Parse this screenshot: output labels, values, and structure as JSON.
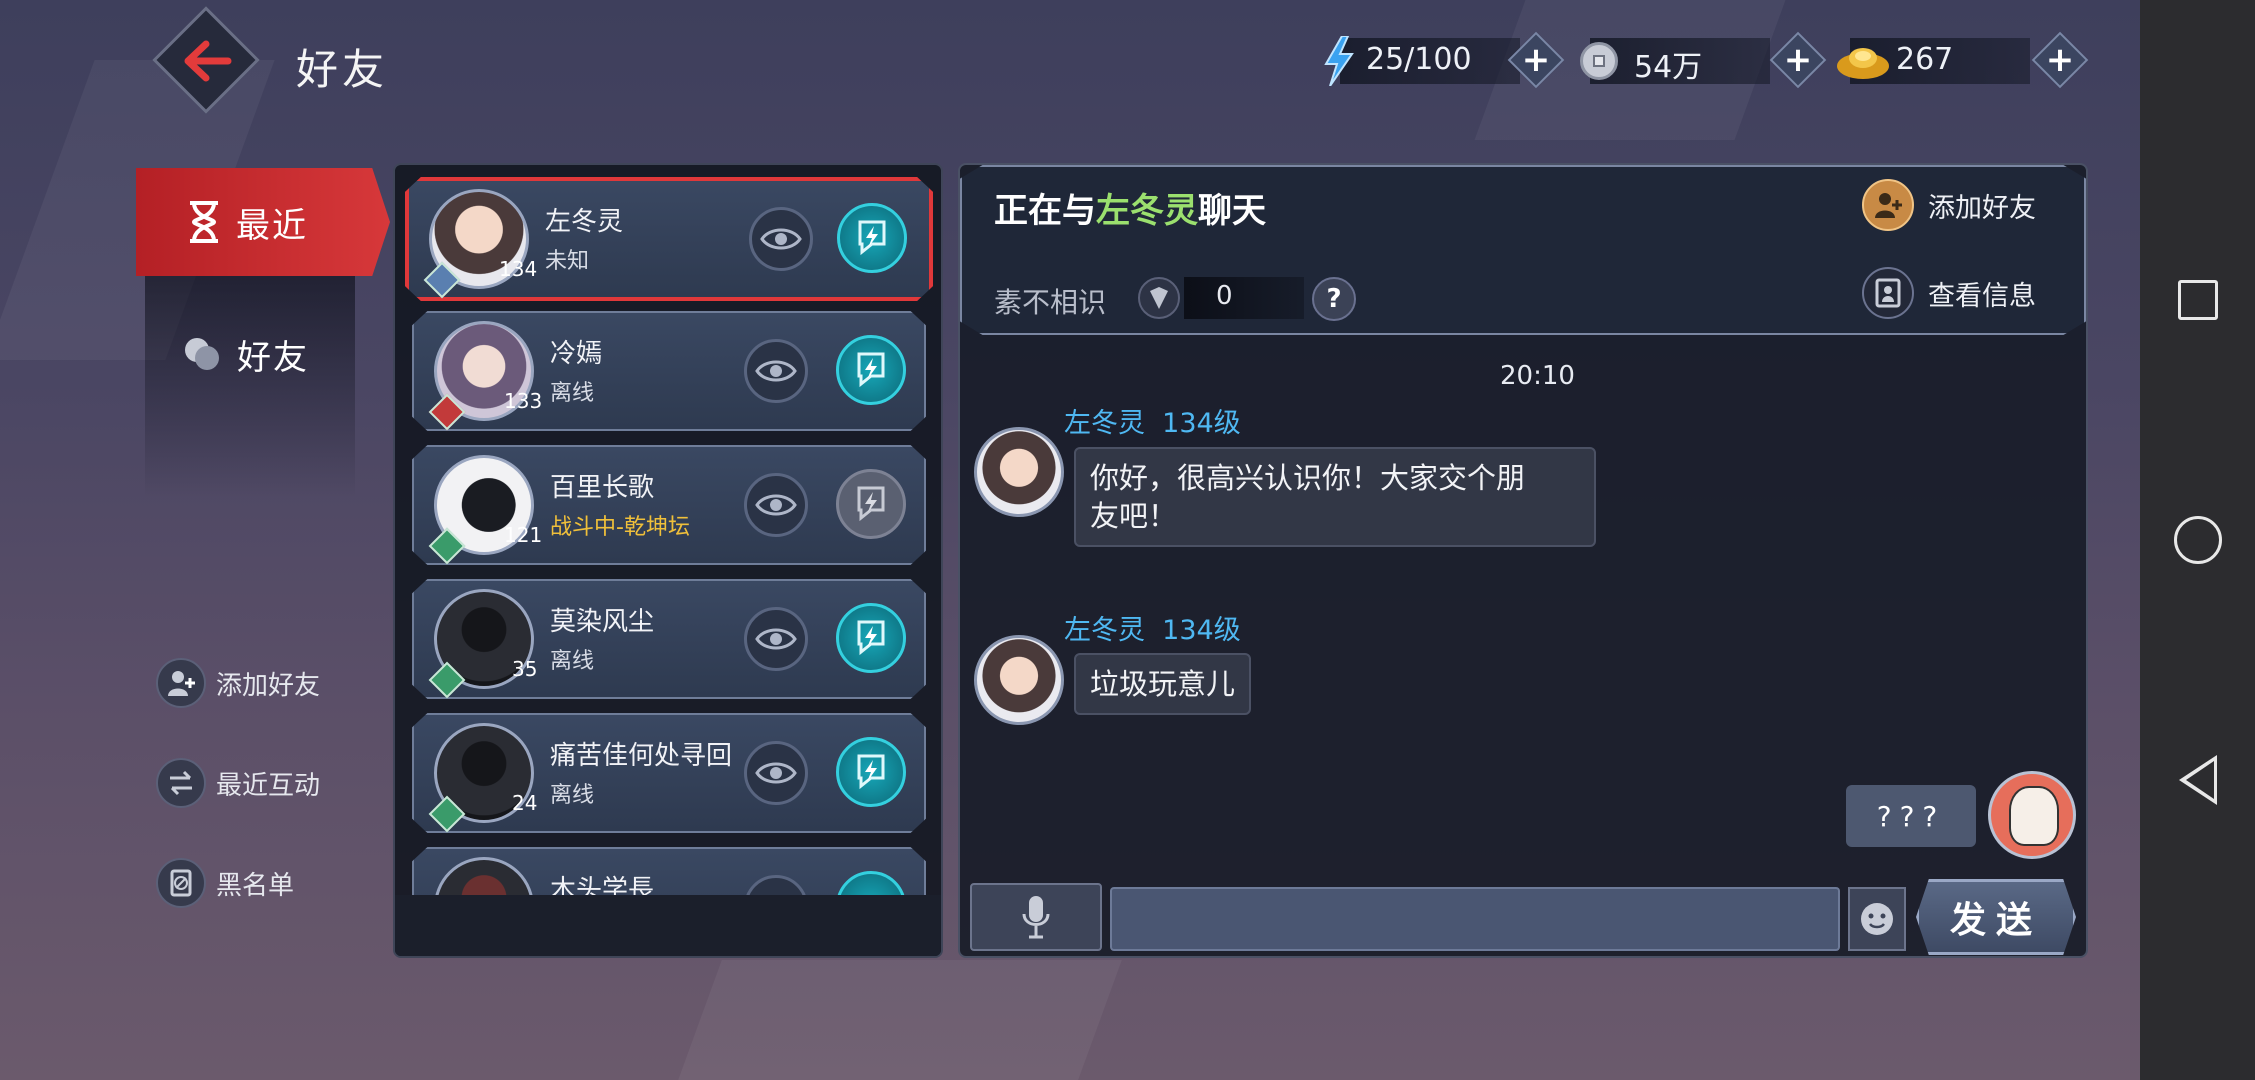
{
  "header": {
    "title": "好友",
    "resources": {
      "stamina": "25/100",
      "silver": "54万",
      "gold": "267"
    }
  },
  "sidebar": {
    "tabs": [
      {
        "label": "最近",
        "active": true
      },
      {
        "label": "好友",
        "active": false
      }
    ],
    "actions": [
      {
        "label": "添加好友"
      },
      {
        "label": "最近互动"
      },
      {
        "label": "黑名单"
      }
    ]
  },
  "friends": [
    {
      "name": "左冬灵",
      "level": "134",
      "status": "未知",
      "selected": true
    },
    {
      "name": "冷嫣",
      "level": "133",
      "status": "离线"
    },
    {
      "name": "百里长歌",
      "level": "121",
      "status": "战斗中-乾坤坛"
    },
    {
      "name": "莫染风尘",
      "level": "35",
      "status": "离线"
    },
    {
      "name": "痛苦佳何处寻回",
      "level": "24",
      "status": "离线"
    },
    {
      "name": "木头学長",
      "level": "",
      "status": ""
    }
  ],
  "chat": {
    "title_prefix": "正在与",
    "title_name": "左冬灵",
    "title_suffix": "聊天",
    "relation_label": "素不相识",
    "relation_value": "0",
    "help": "?",
    "add_friend": "添加好友",
    "view_info": "查看信息",
    "time": "20:10",
    "messages": [
      {
        "sender": "左冬灵",
        "level": "134级",
        "text_line1": "你好，很高兴认识你！大家交个朋",
        "text_line2": "友吧！"
      },
      {
        "sender": "左冬灵",
        "level": "134级",
        "text_line1": "垃圾玩意儿"
      }
    ],
    "my_message": "???",
    "input_placeholder": "",
    "send": "发送"
  },
  "colors": {
    "accent_red": "#d7383a",
    "accent_teal": "#17a7b8",
    "name_green": "#9be06e",
    "sender_blue": "#4fb8f2",
    "status_fight": "#f0c03a"
  }
}
